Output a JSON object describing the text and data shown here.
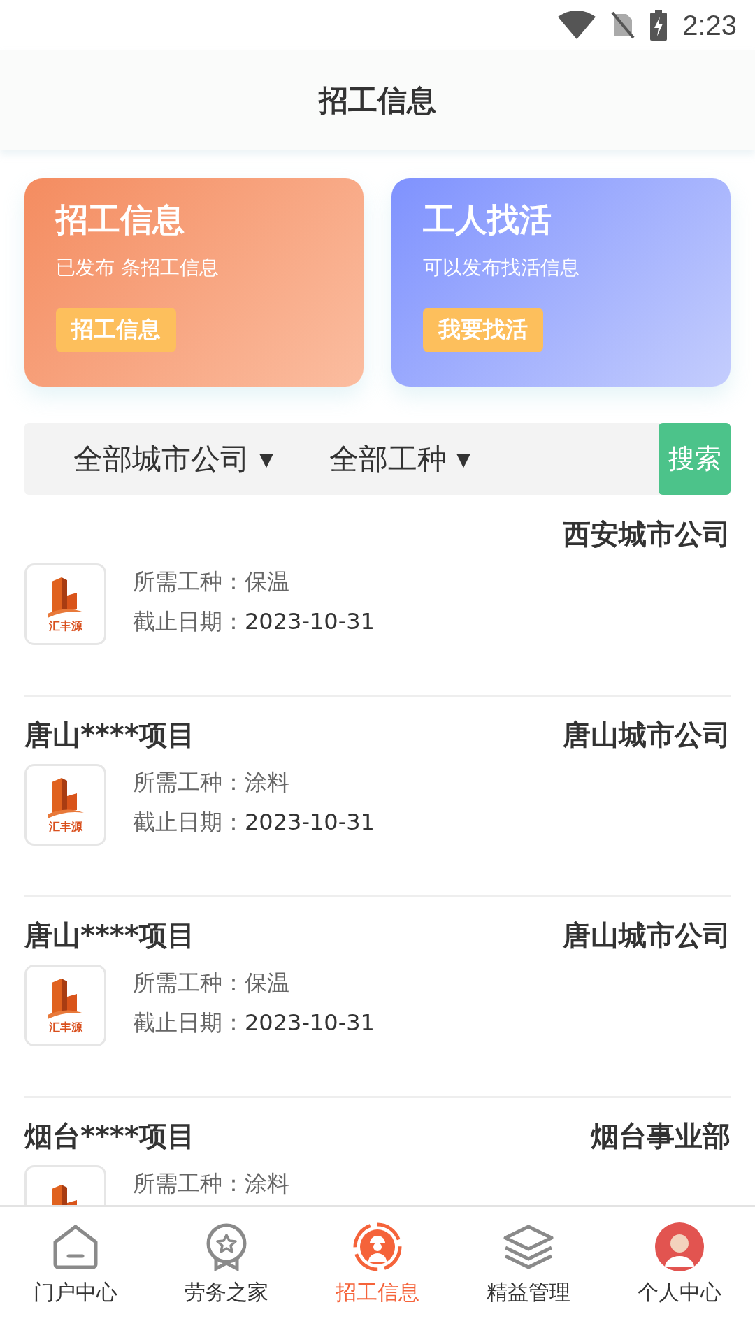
{
  "status_bar": {
    "time": "2:23"
  },
  "header": {
    "title": "招工信息"
  },
  "cards": [
    {
      "kind": "orange",
      "title": "招工信息",
      "subtitle": "已发布 条招工信息",
      "button": "招工信息"
    },
    {
      "kind": "blue",
      "title": "工人找活",
      "subtitle": "可以发布找活信息",
      "button": "我要找活"
    }
  ],
  "filters": [
    {
      "label": "全部城市公司",
      "arrow": "▼"
    },
    {
      "label": "全部工种",
      "arrow": "▼"
    }
  ],
  "search_button": "搜索",
  "jobs": [
    {
      "company": "西安城市公司",
      "logo_text": "汇丰源",
      "trade_label": "所需工种：",
      "trade": "保温",
      "deadline_label": "截止日期：",
      "deadline": "2023-10-31"
    },
    {
      "title": "唐山****项目",
      "company": "唐山城市公司",
      "logo_text": "汇丰源",
      "trade_label": "所需工种：",
      "trade": "涂料",
      "deadline_label": "截止日期：",
      "deadline": "2023-10-31"
    },
    {
      "title": "唐山****项目",
      "company": "唐山城市公司",
      "logo_text": "汇丰源",
      "trade_label": "所需工种：",
      "trade": "保温",
      "deadline_label": "截止日期：",
      "deadline": "2023-10-31"
    },
    {
      "title": "烟台****项目",
      "company": "烟台事业部",
      "trade_label": "所需工种：",
      "trade": "涂料"
    }
  ],
  "tab_bar": [
    {
      "label": "门户中心",
      "kind": "home",
      "selected": false
    },
    {
      "label": "劳务之家",
      "kind": "medal",
      "selected": false
    },
    {
      "label": "招工信息",
      "kind": "worker",
      "selected": true
    },
    {
      "label": "精益管理",
      "kind": "layers",
      "selected": false
    },
    {
      "label": "个人中心",
      "kind": "avatar",
      "selected": false
    }
  ]
}
